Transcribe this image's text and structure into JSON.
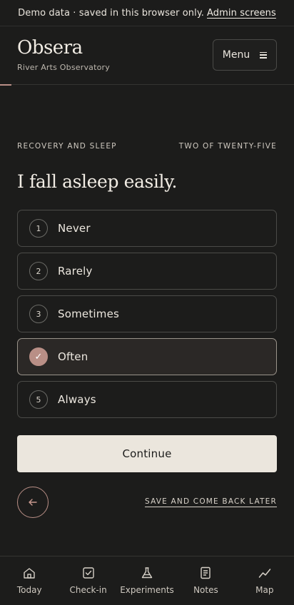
{
  "banner": {
    "text": "Demo data · saved in this browser only.",
    "link_label": "Admin screens"
  },
  "header": {
    "brand_name": "Obsera",
    "brand_subtitle": "River Arts Observatory",
    "menu_label": "Menu",
    "progress_fraction": 0.04
  },
  "question": {
    "section": "RECOVERY AND SLEEP",
    "counter": "TWO OF TWENTY-FIVE",
    "prompt": "I fall asleep easily."
  },
  "options": [
    {
      "number": "1",
      "label": "Never",
      "selected": false
    },
    {
      "number": "2",
      "label": "Rarely",
      "selected": false
    },
    {
      "number": "3",
      "label": "Sometimes",
      "selected": false
    },
    {
      "number": "4",
      "label": "Often",
      "selected": true
    },
    {
      "number": "5",
      "label": "Always",
      "selected": false
    }
  ],
  "selected_mark": "✓",
  "actions": {
    "continue_label": "Continue",
    "save_label": "SAVE AND COME BACK LATER"
  },
  "nav": [
    {
      "label": "Today",
      "icon": "home-icon"
    },
    {
      "label": "Check-in",
      "icon": "checkbox-icon"
    },
    {
      "label": "Experiments",
      "icon": "flask-icon"
    },
    {
      "label": "Notes",
      "icon": "notes-icon"
    },
    {
      "label": "Map",
      "icon": "chart-line-icon"
    }
  ],
  "colors": {
    "background": "#1c1c1b",
    "accent": "#b98f86",
    "primary_button": "#ebe6dd"
  }
}
